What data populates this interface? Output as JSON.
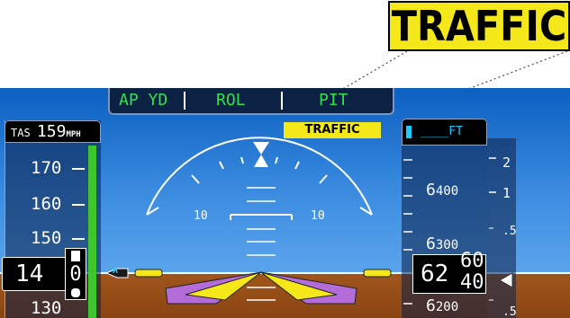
{
  "callout": {
    "text": "TRAFFIC"
  },
  "ap_bar": {
    "ap_yd": "AP YD",
    "lateral": "ROL",
    "vertical": "PIT"
  },
  "annunciation": {
    "traffic": "TRAFFIC"
  },
  "airspeed": {
    "tas_label": "TAS",
    "tas_value": "159",
    "tas_unit": "MPH",
    "tape": [
      "170",
      "160",
      "150",
      "130"
    ],
    "current_main": "14",
    "current_last": "0"
  },
  "attitude": {
    "pitch_left": "10",
    "pitch_right": "10",
    "fd_marker": "A"
  },
  "altimeter": {
    "selected": "____FT",
    "tape_big": [
      "6",
      "6",
      "6"
    ],
    "tape_small": [
      "400",
      "300",
      "200"
    ],
    "current_main": "62",
    "current_upper": "60",
    "current_lower": "40"
  },
  "vsi": {
    "labels": [
      "2",
      "1",
      ".5",
      ".5"
    ]
  },
  "colors": {
    "sky": "#3e8ee2",
    "ground": "#8b4513",
    "ap_text": "#33e04a",
    "annunciator": "#f4e81a"
  }
}
